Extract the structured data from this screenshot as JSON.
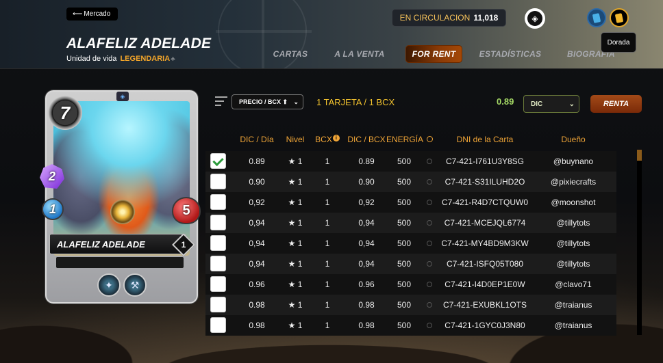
{
  "header": {
    "back_label": "Mercado",
    "card_name": "ALAFELIZ ADELADE",
    "subtitle_prefix": "Unidad de vida",
    "rarity": "LEGENDARIA",
    "circulation_label": "EN CIRCULACION",
    "circulation_value": "11,018",
    "tooltip": "Dorada",
    "nav": [
      {
        "label": "CARTAS",
        "active": false
      },
      {
        "label": "A LA VENTA",
        "active": false
      },
      {
        "label": "FOR RENT",
        "active": true
      },
      {
        "label": "ESTADÍSTICAS",
        "active": false
      },
      {
        "label": "BIOGRAFIA",
        "active": false
      }
    ]
  },
  "card": {
    "mana": "7",
    "speed": "2",
    "magic": "1",
    "health": "5",
    "name": "ALAFELIZ ADELADE",
    "level": "1",
    "abilities": [
      "wings-icon",
      "hammer-icon"
    ]
  },
  "controls": {
    "sort_label": "PRECIO / BCX ⬆",
    "bcx_info": "1 TARJETA / 1 BCX",
    "price": "0.89",
    "currency": "DIC",
    "rent_label": "RENTA"
  },
  "table": {
    "headers": {
      "price_day": "DIC / Día",
      "level": "Nivel",
      "bcx": "BCX",
      "price_bcx": "DIC / BCX",
      "energy": "ENERGÍA",
      "card_id": "DNI de la Carta",
      "owner": "Dueño"
    },
    "rows": [
      {
        "checked": true,
        "price": "0.89",
        "level": "★ 1",
        "bcx": "1",
        "price_bcx": "0.89",
        "energy": "500",
        "id": "C7-421-I761U3Y8SG",
        "owner": "@buynano"
      },
      {
        "checked": false,
        "price": "0.90",
        "level": "★ 1",
        "bcx": "1",
        "price_bcx": "0.90",
        "energy": "500",
        "id": "C7-421-S31ILUHD2O",
        "owner": "@pixiecrafts"
      },
      {
        "checked": false,
        "price": "0,92",
        "level": "★ 1",
        "bcx": "1",
        "price_bcx": "0,92",
        "energy": "500",
        "id": "C7-421-R4D7CTQUW0",
        "owner": "@moonshot"
      },
      {
        "checked": false,
        "price": "0,94",
        "level": "★ 1",
        "bcx": "1",
        "price_bcx": "0,94",
        "energy": "500",
        "id": "C7-421-MCEJQL6774",
        "owner": "@tillytots"
      },
      {
        "checked": false,
        "price": "0,94",
        "level": "★ 1",
        "bcx": "1",
        "price_bcx": "0,94",
        "energy": "500",
        "id": "C7-421-MY4BD9M3KW",
        "owner": "@tillytots"
      },
      {
        "checked": false,
        "price": "0,94",
        "level": "★ 1",
        "bcx": "1",
        "price_bcx": "0,94",
        "energy": "500",
        "id": "C7-421-ISFQ05T080",
        "owner": "@tillytots"
      },
      {
        "checked": false,
        "price": "0.96",
        "level": "★ 1",
        "bcx": "1",
        "price_bcx": "0.96",
        "energy": "500",
        "id": "C7-421-I4D0EP1E0W",
        "owner": "@clavo71"
      },
      {
        "checked": false,
        "price": "0.98",
        "level": "★ 1",
        "bcx": "1",
        "price_bcx": "0.98",
        "energy": "500",
        "id": "C7-421-EXUBKL1OTS",
        "owner": "@traianus"
      },
      {
        "checked": false,
        "price": "0.98",
        "level": "★ 1",
        "bcx": "1",
        "price_bcx": "0.98",
        "energy": "500",
        "id": "C7-421-1GYC0J3N80",
        "owner": "@traianus"
      }
    ]
  },
  "colors": {
    "accent_orange": "#f0a537",
    "rarity_gold": "#f2a52a",
    "price_green": "#a4d865",
    "rent_brown": "#a34a18"
  }
}
